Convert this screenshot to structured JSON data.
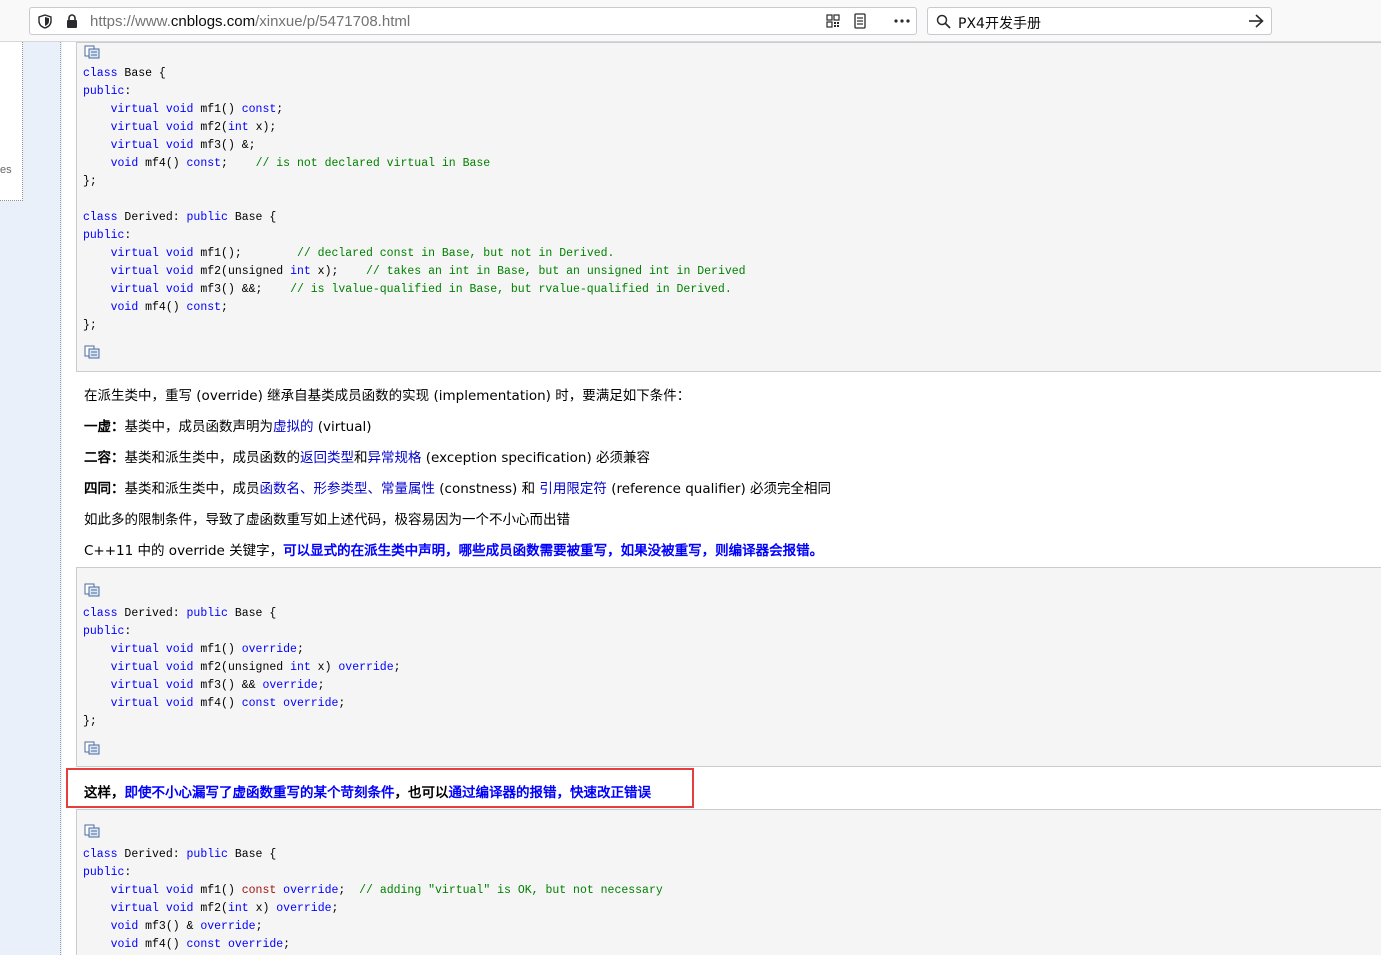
{
  "browser": {
    "url_prefix": "https://www.",
    "url_host": "cnblogs.com",
    "url_path": "/xinxue/p/5471708.html",
    "search_text": "PX4开发手册",
    "icons": [
      "shield-icon",
      "lock-icon",
      "qr-code-icon",
      "reader-view-icon",
      "more-icon",
      "search-icon",
      "arrow-right-icon"
    ]
  },
  "sidebar": {
    "fragment": "es"
  },
  "code1": {
    "lines": [
      "class Base {",
      "public:",
      "    virtual void mf1() const;",
      "    virtual void mf2(int x);",
      "    virtual void mf3() &;",
      "    void mf4() const;    // is not declared virtual in Base",
      "};",
      "",
      "class Derived: public Base {",
      "public:",
      "    virtual void mf1();        // declared const in Base, but not in Derived.",
      "    virtual void mf2(unsigned int x);    // takes an int in Base, but an unsigned int in Derived",
      "    virtual void mf3() &&;    // is lvalue-qualified in Base, but rvalue-qualified in Derived.",
      "    void mf4() const;",
      "};"
    ]
  },
  "text": {
    "intro": "在派生类中，重写 (override) 继承自基类成员函数的实现 (implementation) 时，要满足如下条件：",
    "c1_label": "一虚：",
    "c1_a": "基类中，成员函数声明为",
    "c1_link": "虚拟的",
    "c1_b": " (virtual)",
    "c2_label": "二容：",
    "c2_a": "基类和派生类中，成员函数的",
    "c2_link1": "返回类型",
    "c2_mid": "和",
    "c2_link2": "异常规格",
    "c2_b": " (exception specification) 必须兼容",
    "c3_label": "四同：",
    "c3_a": "基类和派生类中，成员",
    "c3_link1": "函数名、形参类型、常量属性",
    "c3_b": " (constness) 和 ",
    "c3_link2": "引用限定符",
    "c3_c": " (reference qualifier) 必须完全相同",
    "many": "如此多的限制条件，导致了虚函数重写如上述代码，极容易因为一个不小心而出错",
    "override_a": "C++11 中的 override 关键字，",
    "override_b": "可以显式的在派生类中声明，哪些成员函数需要被重写，如果没被重写，则编译器会报错。",
    "hl_a": "这样，",
    "hl_b": "即使不小心漏写了虚函数重写的某个苛刻条件",
    "hl_c": "，也可以",
    "hl_d": "通过编译器的报错，快速改正错误"
  },
  "code2": {
    "lines": [
      "class Derived: public Base {",
      "public:",
      "    virtual void mf1() override;",
      "    virtual void mf2(unsigned int x) override;",
      "    virtual void mf3() && override;",
      "    virtual void mf4() const override;",
      "};"
    ]
  },
  "code3": {
    "lines": [
      "class Derived: public Base {",
      "public:",
      "    virtual void mf1() const override;  // adding \"virtual\" is OK, but not necessary",
      "    virtual void mf2(int x) override;",
      "    void mf3() & override;",
      "    void mf4() const override;"
    ]
  }
}
